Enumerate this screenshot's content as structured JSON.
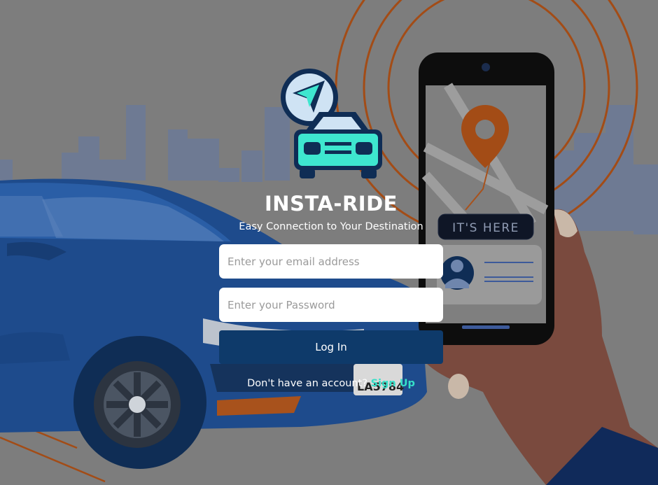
{
  "app": {
    "title": "INSTA-RIDE",
    "subtitle": "Easy Connection to Your Destination"
  },
  "phone": {
    "banner": "IT'S HERE"
  },
  "car": {
    "plate": "LA5784"
  },
  "form": {
    "email_placeholder": "Enter your email address",
    "password_placeholder": "Enter your Password",
    "login_label": "Log In",
    "signup_prompt": "Don't have an account?",
    "signup_link": "Sign Up"
  },
  "colors": {
    "background": "#7d7d7d",
    "car_blue": "#1e4b8c",
    "accent_orange": "#a8521c",
    "logo_teal": "#3ee6cf",
    "button_navy": "#0e3a6a",
    "link_teal": "#36e0c8"
  },
  "icons": {
    "logo": "car-with-navigation-arrow-icon",
    "map_pin": "location-pin-icon",
    "user": "user-avatar-icon"
  }
}
